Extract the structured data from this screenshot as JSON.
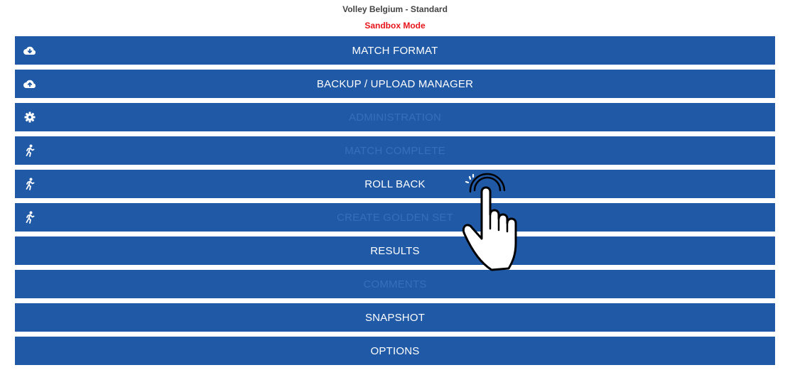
{
  "header": {
    "title": "Volley Belgium - Standard",
    "mode": "Sandbox Mode"
  },
  "menu": [
    {
      "label": "MATCH FORMAT",
      "icon": "cloud-download-icon",
      "enabled": true
    },
    {
      "label": "BACKUP / UPLOAD MANAGER",
      "icon": "cloud-upload-icon",
      "enabled": true
    },
    {
      "label": "ADMINISTRATION",
      "icon": "gear-icon",
      "enabled": false
    },
    {
      "label": "MATCH COMPLETE",
      "icon": "running-person-icon",
      "enabled": false
    },
    {
      "label": "ROLL BACK",
      "icon": "running-person-icon",
      "enabled": true
    },
    {
      "label": "CREATE GOLDEN SET",
      "icon": "running-person-icon",
      "enabled": false
    },
    {
      "label": "RESULTS",
      "icon": "",
      "enabled": true
    },
    {
      "label": "COMMENTS",
      "icon": "",
      "enabled": false
    },
    {
      "label": "SNAPSHOT",
      "icon": "",
      "enabled": true
    },
    {
      "label": "OPTIONS",
      "icon": "",
      "enabled": true
    }
  ],
  "colors": {
    "button": "#2059a6",
    "enabled_text": "#ffffff",
    "disabled_text": "#3670ba",
    "mode_text": "#e8141a"
  }
}
